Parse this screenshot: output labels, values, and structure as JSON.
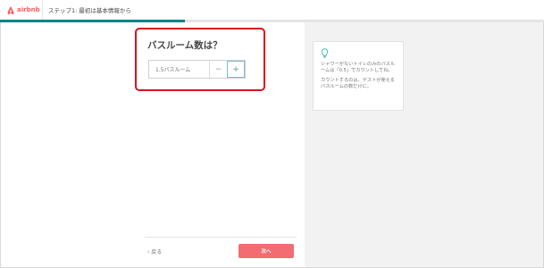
{
  "app": {
    "logo_text": "airbnb",
    "brand_color": "#ff5a5f"
  },
  "header": {
    "step_title": "ステップ1: 最初は基本情報から"
  },
  "progress": {
    "percent": 34,
    "color": "#008489"
  },
  "main": {
    "question": "バスルーム数は？",
    "stepper": {
      "value": "1.5バスルーム",
      "minus_label": "−",
      "plus_label": "+"
    }
  },
  "tip": {
    "icon": "lightbulb-icon",
    "paragraphs": [
      "シャワーがないトイレのみのバスルームは「0.5」でカウントしてね。",
      "カウントするのは、ゲストが使えるバスルームの数だけに。"
    ]
  },
  "footer": {
    "back_label": "‹ 戻る",
    "next_label": "次へ"
  }
}
